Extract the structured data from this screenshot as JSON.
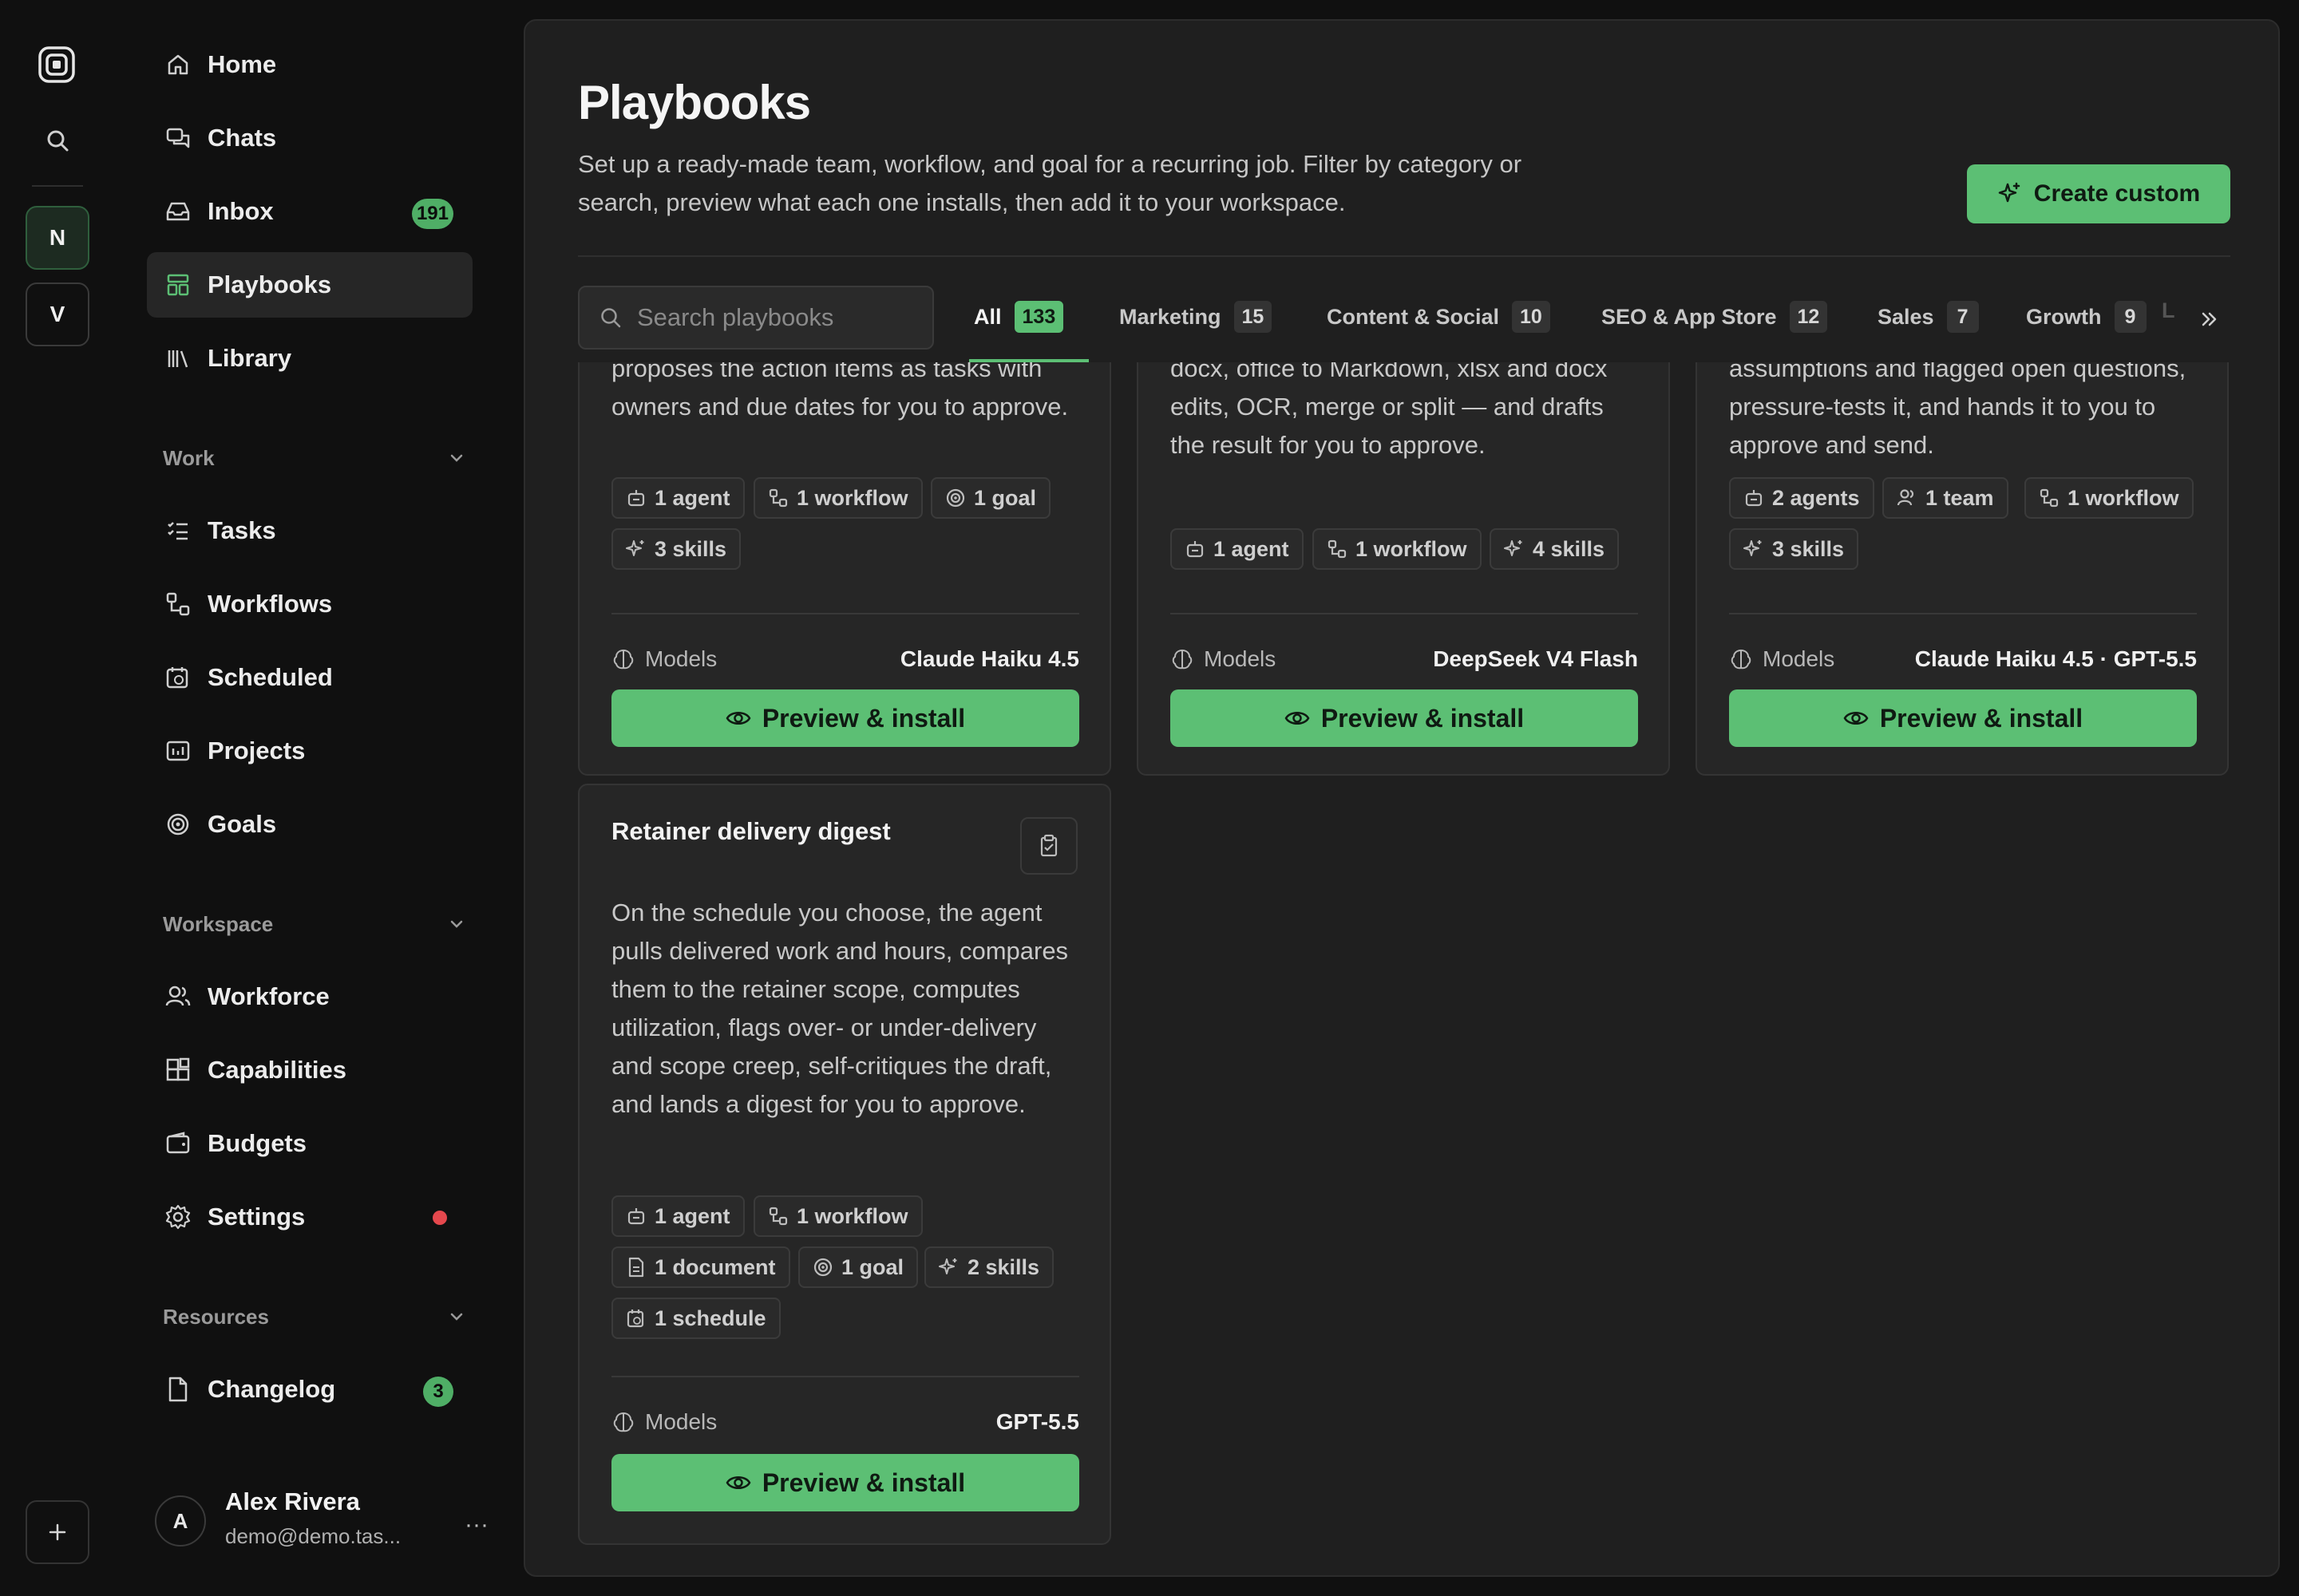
{
  "rail": {
    "workspaces": [
      "N",
      "V"
    ]
  },
  "nav": {
    "home": "Home",
    "chats": "Chats",
    "inbox": "Inbox",
    "inbox_badge": "191",
    "playbooks": "Playbooks",
    "library": "Library",
    "work_section": "Work",
    "tasks": "Tasks",
    "workflows": "Workflows",
    "scheduled": "Scheduled",
    "projects": "Projects",
    "goals": "Goals",
    "workspace_section": "Workspace",
    "workforce": "Workforce",
    "capabilities": "Capabilities",
    "budgets": "Budgets",
    "settings": "Settings",
    "resources_section": "Resources",
    "changelog": "Changelog",
    "changelog_badge": "3"
  },
  "user": {
    "initial": "A",
    "name": "Alex Rivera",
    "email": "demo@demo.tas...",
    "more": "···"
  },
  "page": {
    "title": "Playbooks",
    "description": "Set up a ready-made team, workflow, and goal for a recurring job. Filter by category or search, preview what each one installs, then add it to your workspace.",
    "create_label": "Create custom"
  },
  "filters": {
    "search_placeholder": "Search playbooks",
    "tabs": [
      {
        "label": "All",
        "count": "133"
      },
      {
        "label": "Marketing",
        "count": "15"
      },
      {
        "label": "Content & Social",
        "count": "10"
      },
      {
        "label": "SEO & App Store",
        "count": "12"
      },
      {
        "label": "Sales",
        "count": "7"
      },
      {
        "label": "Growth",
        "count": "9"
      }
    ],
    "overflow_text": "L"
  },
  "cards": [
    {
      "desc": "proposes the action items as tasks with owners and due dates for you to approve.",
      "chips": [
        "1 agent",
        "1 workflow",
        "1 goal",
        "3 skills"
      ],
      "models_label": "Models",
      "models": "Claude Haiku 4.5",
      "install_label": "Preview & install"
    },
    {
      "desc": "docx, office to Markdown, xlsx and docx edits, OCR, merge or split — and drafts the result for you to approve.",
      "chips": [
        "1 agent",
        "1 workflow",
        "4 skills"
      ],
      "models_label": "Models",
      "models": "DeepSeek V4 Flash",
      "install_label": "Preview & install"
    },
    {
      "desc": "assumptions and flagged open questions, pressure-tests it, and hands it to you to approve and send.",
      "chips": [
        "2 agents",
        "1 team",
        "1 workflow",
        "3 skills"
      ],
      "models_label": "Models",
      "models": "Claude Haiku 4.5 · GPT-5.5",
      "install_label": "Preview & install"
    },
    {
      "title": "Retainer delivery digest",
      "desc": "On the schedule you choose, the agent pulls delivered work and hours, compares them to the retainer scope, computes utilization, flags over- or under-delivery and scope creep, self-critiques the draft, and lands a digest for you to approve.",
      "chips": [
        "1 agent",
        "1 workflow",
        "1 document",
        "1 goal",
        "2 skills",
        "1 schedule"
      ],
      "models_label": "Models",
      "models": "GPT-5.5",
      "install_label": "Preview & install"
    }
  ]
}
